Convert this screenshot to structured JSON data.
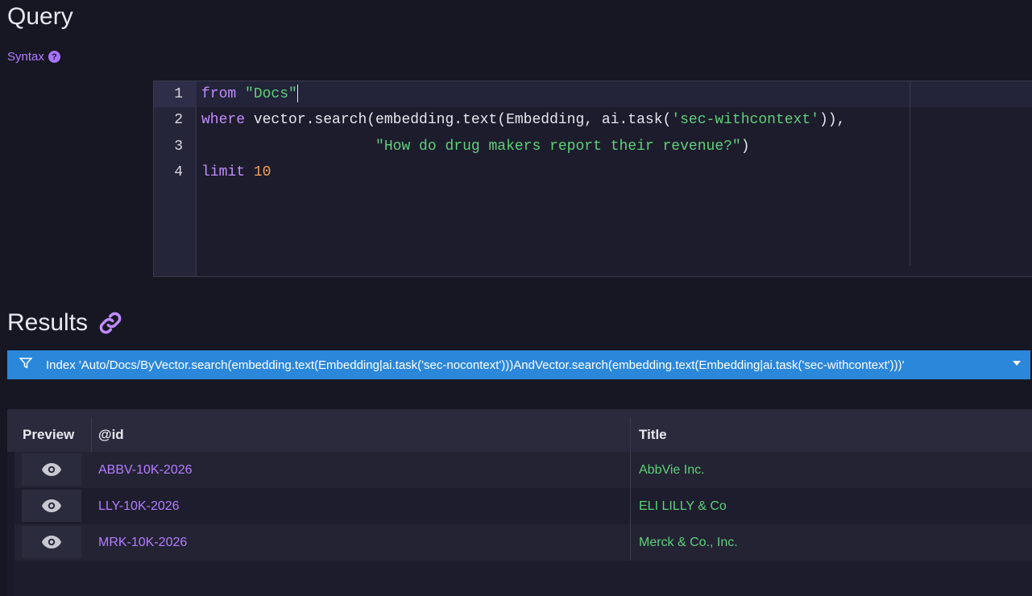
{
  "query": {
    "title": "Query",
    "syntax_label": "Syntax",
    "help_glyph": "?",
    "line_numbers": [
      "1",
      "2",
      "3",
      "4"
    ],
    "code": {
      "line1_kw": "from",
      "line1_str": "\"Docs\"",
      "line2_kw": "where",
      "line2_a": " vector.search(embedding.text(Embedding, ai.task(",
      "line2_str": "'sec-withcontext'",
      "line2_b": ")),",
      "line3_pad": "                    ",
      "line3_str": "\"How do drug makers report their revenue?\"",
      "line3_b": ")",
      "line4_kw": "limit",
      "line4_num": "10"
    }
  },
  "results": {
    "title": "Results",
    "index_label": "Index 'Auto/Docs/ByVector.search(embedding.text(Embedding|ai.task('sec-nocontext')))AndVector.search(embedding.text(Embedding|ai.task('sec-withcontext')))'",
    "columns": [
      "Preview",
      "@id",
      "Title"
    ],
    "rows": [
      {
        "id": "ABBV-10K-2026",
        "title": "AbbVie Inc."
      },
      {
        "id": "LLY-10K-2026",
        "title": "ELI LILLY & Co"
      },
      {
        "id": "MRK-10K-2026",
        "title": "Merck & Co., Inc."
      }
    ]
  },
  "colors": {
    "background": "#171724",
    "accent_purple": "#b57dff",
    "string_green": "#5fd07a",
    "number_orange": "#f0a060",
    "index_bar_blue": "#2b87d9"
  },
  "icons": {
    "help": "question-circle-icon",
    "results_link": "link-icon",
    "index_bar": "filter-funnel-icon",
    "index_dropdown": "caret-down-icon",
    "preview": "eye-icon"
  }
}
